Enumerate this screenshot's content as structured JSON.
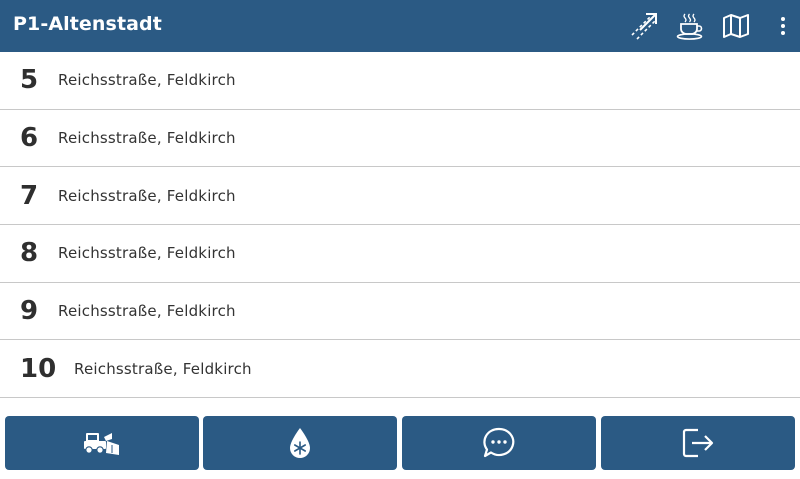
{
  "header": {
    "title": "P1-Altenstadt",
    "actions": [
      {
        "icon": "route-arrow-icon"
      },
      {
        "icon": "coffee-cup-icon"
      },
      {
        "icon": "map-icon"
      },
      {
        "icon": "more-vert-icon"
      }
    ]
  },
  "list": {
    "items": [
      {
        "number": "5",
        "address": "Reichsstraße, Feldkirch"
      },
      {
        "number": "6",
        "address": "Reichsstraße, Feldkirch"
      },
      {
        "number": "7",
        "address": "Reichsstraße, Feldkirch"
      },
      {
        "number": "8",
        "address": "Reichsstraße, Feldkirch"
      },
      {
        "number": "9",
        "address": "Reichsstraße, Feldkirch"
      },
      {
        "number": "10",
        "address": "Reichsstraße, Feldkirch"
      }
    ]
  },
  "bottom_bar": {
    "buttons": [
      {
        "icon": "snowplow-truck-icon"
      },
      {
        "icon": "snow-drop-icon"
      },
      {
        "icon": "chat-bubble-icon"
      },
      {
        "icon": "logout-icon"
      }
    ]
  },
  "colors": {
    "primary": "#2b5a84",
    "divider": "#c8c8c8",
    "text": "#333333"
  }
}
